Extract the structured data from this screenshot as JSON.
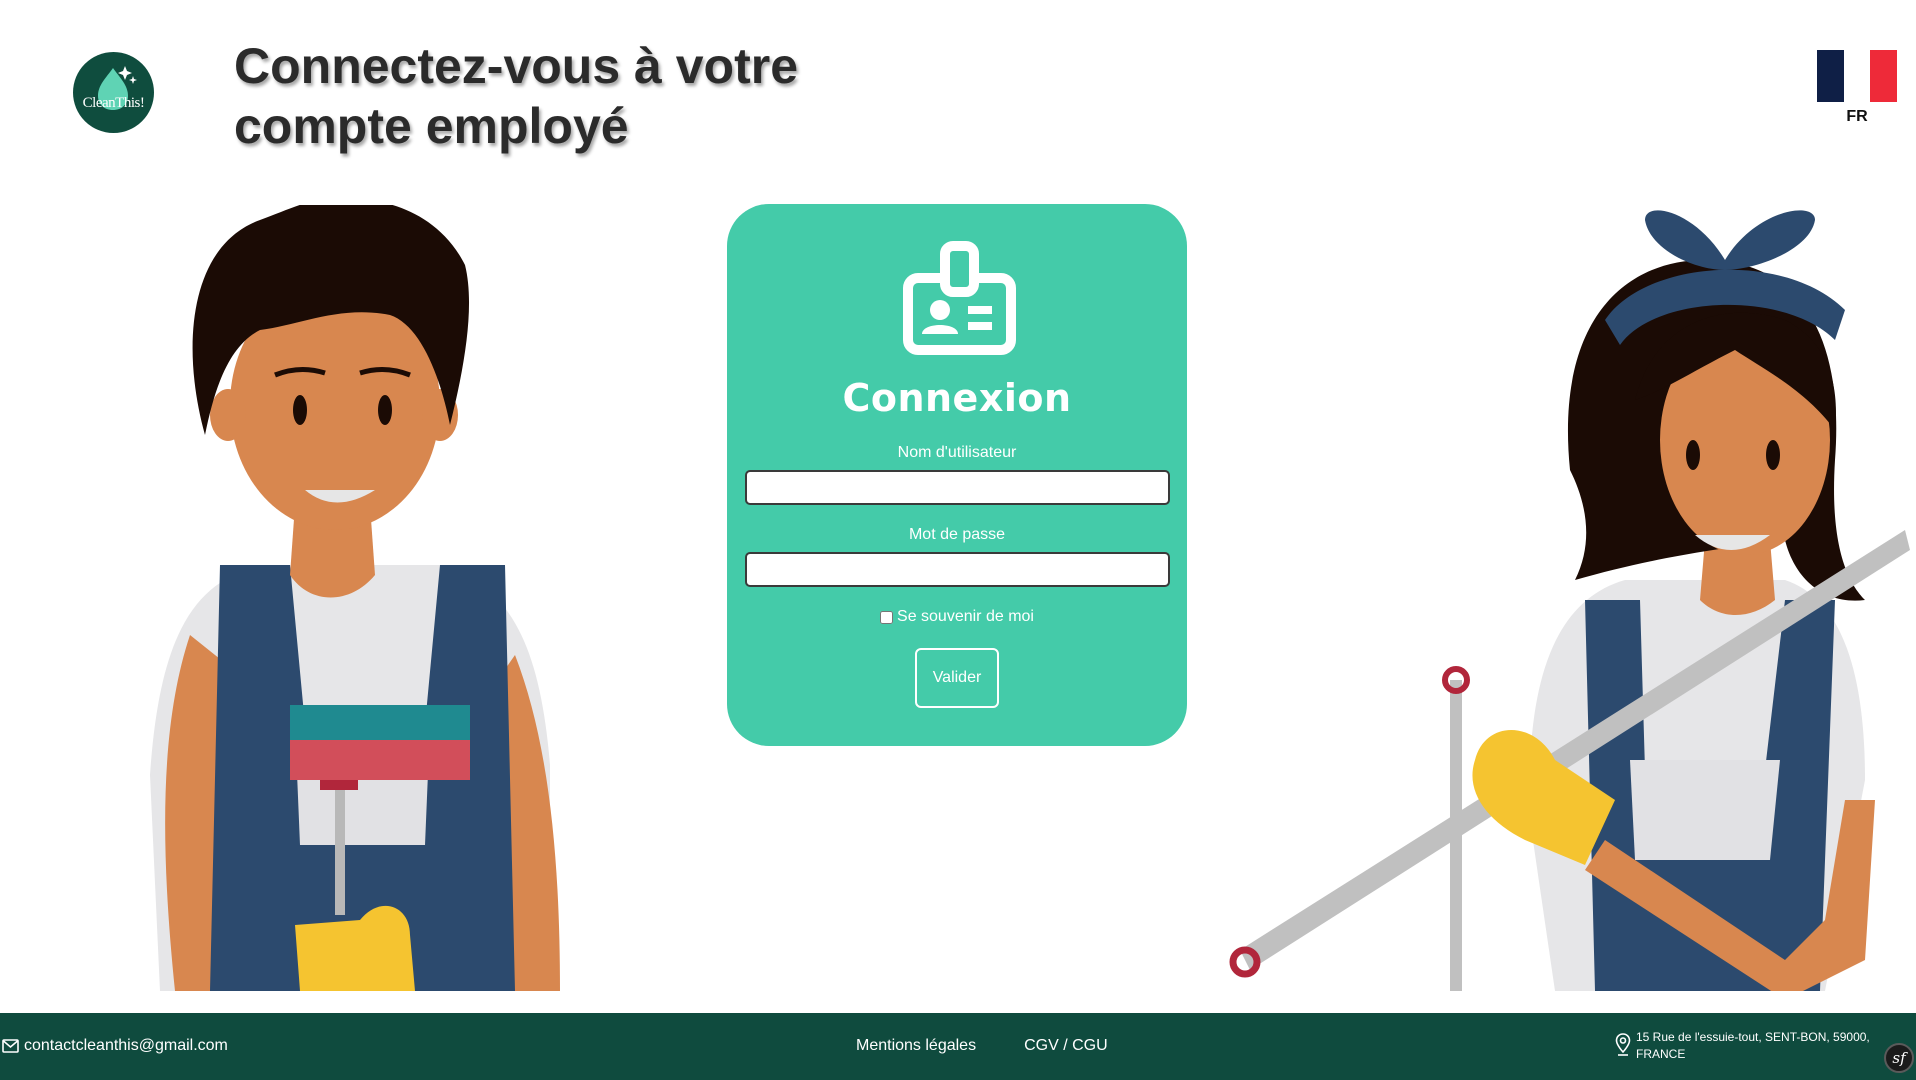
{
  "brand": {
    "logo_text": "CleanThis!",
    "color_dark_green": "#0f4d3e"
  },
  "page": {
    "title": "Connectez-vous à votre compte employé"
  },
  "language": {
    "code": "FR",
    "flag_colors": [
      "#0f1f46",
      "#ffffff",
      "#ee2a39"
    ]
  },
  "login": {
    "icon": "id-badge-icon",
    "title": "Connexion",
    "username_label": "Nom d'utilisateur",
    "username_value": "",
    "password_label": "Mot de passe",
    "password_value": "",
    "remember_label": "Se souvenir de moi",
    "remember_checked": false,
    "submit_label": "Valider",
    "card_color": "#44cba9"
  },
  "illustrations": {
    "left": "male-cleaner-with-squeegee",
    "right": "female-cleaner-with-mop"
  },
  "footer": {
    "email": "contactcleanthis@gmail.com",
    "email_icon": "mail-icon",
    "links": [
      "Mentions légales",
      "CGV / CGU"
    ],
    "address": "15 Rue de l'essuie-tout, SENT-BON, 59000, FRANCE",
    "address_icon": "map-pin-icon",
    "debug_badge": "sf",
    "background": "#0f4b3e"
  }
}
